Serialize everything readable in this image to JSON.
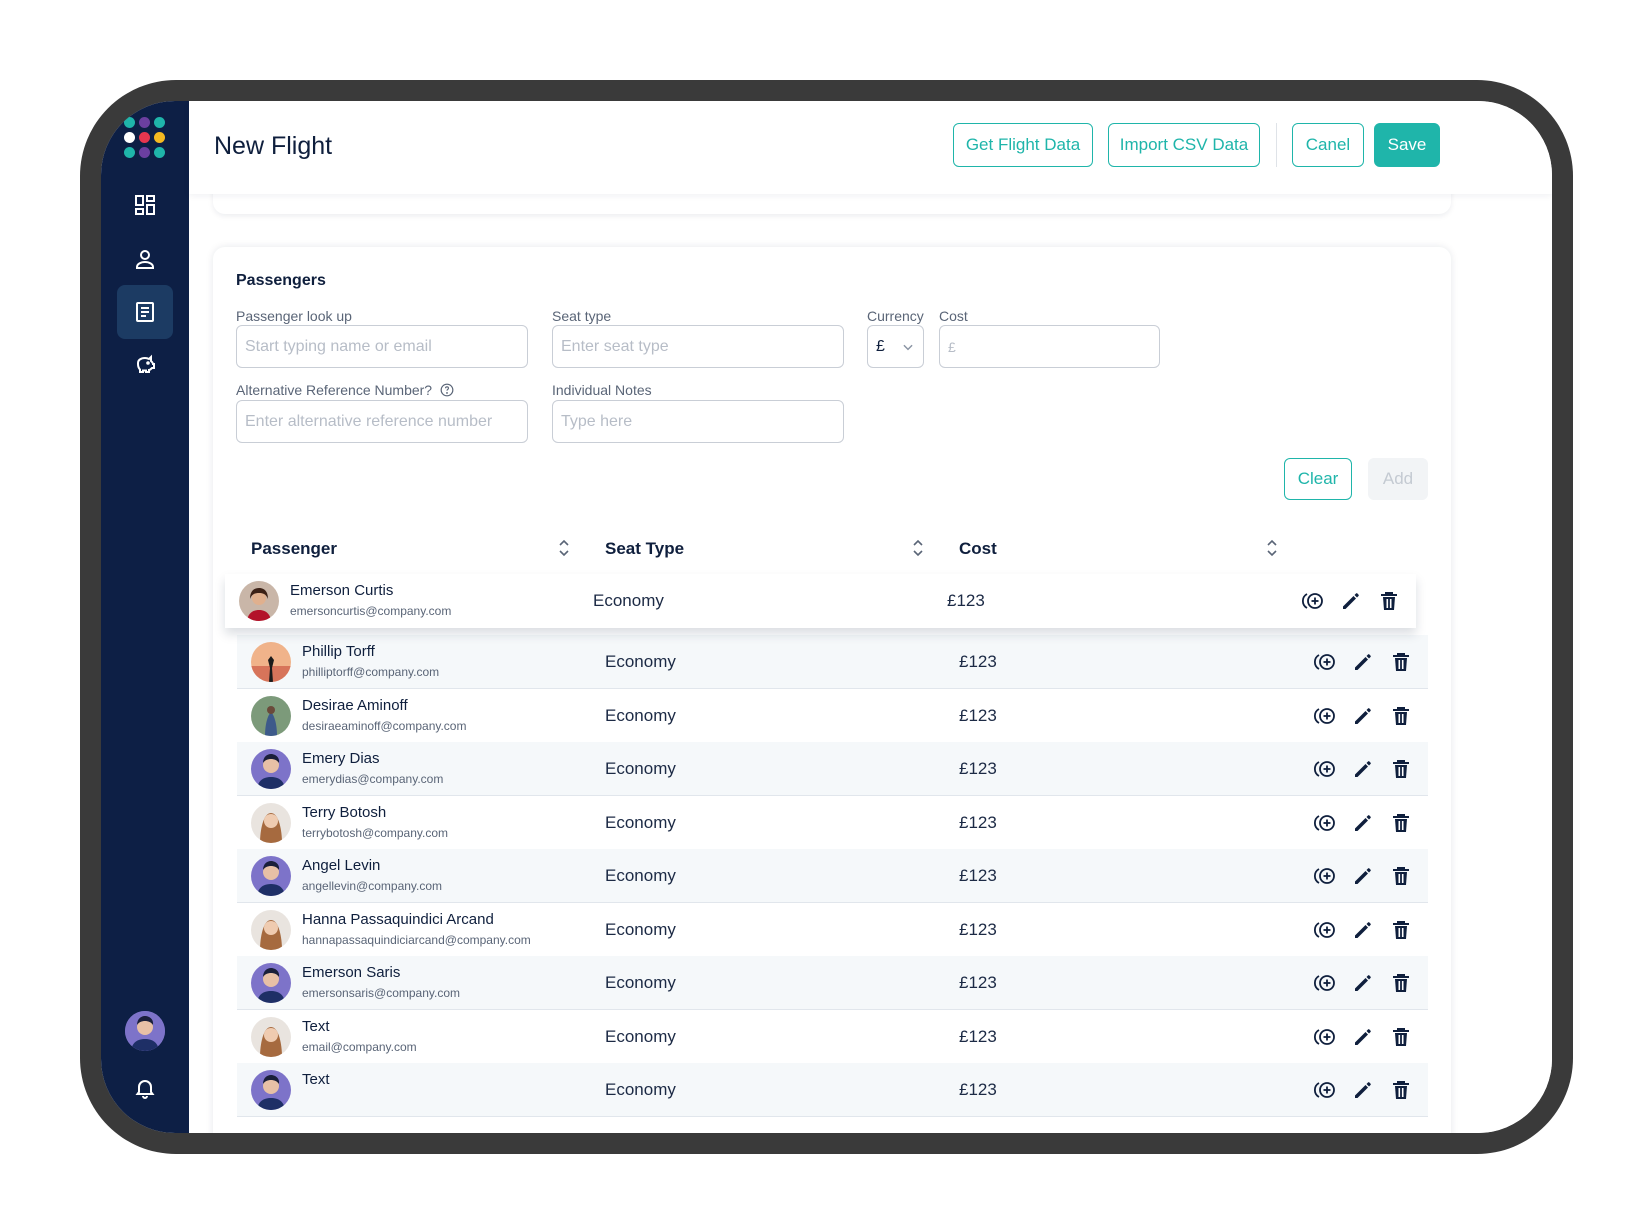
{
  "header": {
    "title": "New Flight",
    "get_flight_data": "Get Flight Data",
    "import_csv": "Import CSV Data",
    "cancel": "Canel",
    "save": "Save"
  },
  "colors": {
    "accent": "#1fb5aa",
    "sidebar": "#0d1f45",
    "sidebar_active": "#1c3b63"
  },
  "sidebar": {
    "logo_dots": [
      "#1fb5aa",
      "#6b3fa0",
      "#1fb5aa",
      "#ffffff",
      "#e8364f",
      "#f5b921",
      "#1fb5aa",
      "#6b3fa0",
      "#1fb5aa"
    ],
    "items": [
      {
        "icon": "dashboard-icon"
      },
      {
        "icon": "user-icon"
      },
      {
        "icon": "document-icon",
        "active": true
      },
      {
        "icon": "piggy-bank-icon"
      }
    ]
  },
  "form": {
    "section_title": "Passengers",
    "lookup_label": "Passenger look up",
    "lookup_placeholder": "Start typing name or email",
    "seat_label": "Seat type",
    "seat_placeholder": "Enter seat type",
    "currency_label": "Currency",
    "currency_value": "£",
    "cost_label": "Cost",
    "cost_placeholder": "£",
    "altref_label": "Alternative Reference Number?",
    "altref_placeholder": "Enter alternative reference number",
    "notes_label": "Individual Notes",
    "notes_placeholder": "Type here",
    "clear": "Clear",
    "add": "Add"
  },
  "table": {
    "columns": [
      "Passenger",
      "Seat Type",
      "Cost"
    ],
    "rows": [
      {
        "name": "Emerson Curtis",
        "email": "emersoncurtis@company.com",
        "seat": "Economy",
        "cost": "£123"
      },
      {
        "name": "Phillip Torff",
        "email": "philliptorff@company.com",
        "seat": "Economy",
        "cost": "£123"
      },
      {
        "name": "Desirae Aminoff",
        "email": "desiraeaminoff@company.com",
        "seat": "Economy",
        "cost": "£123"
      },
      {
        "name": "Emery Dias",
        "email": "emerydias@company.com",
        "seat": "Economy",
        "cost": "£123"
      },
      {
        "name": "Terry Botosh",
        "email": "terrybotosh@company.com",
        "seat": "Economy",
        "cost": "£123"
      },
      {
        "name": "Angel Levin",
        "email": "angellevin@company.com",
        "seat": "Economy",
        "cost": "£123"
      },
      {
        "name": "Hanna Passaquindici Arcand",
        "email": "hannapassaquindiciarcand@company.com",
        "seat": "Economy",
        "cost": "£123"
      },
      {
        "name": "Emerson Saris",
        "email": "emersonsaris@company.com",
        "seat": "Economy",
        "cost": "£123"
      },
      {
        "name": "Text",
        "email": "email@company.com",
        "seat": "Economy",
        "cost": "£123"
      },
      {
        "name": "Text",
        "email": "",
        "seat": "Economy",
        "cost": "£123"
      }
    ]
  }
}
